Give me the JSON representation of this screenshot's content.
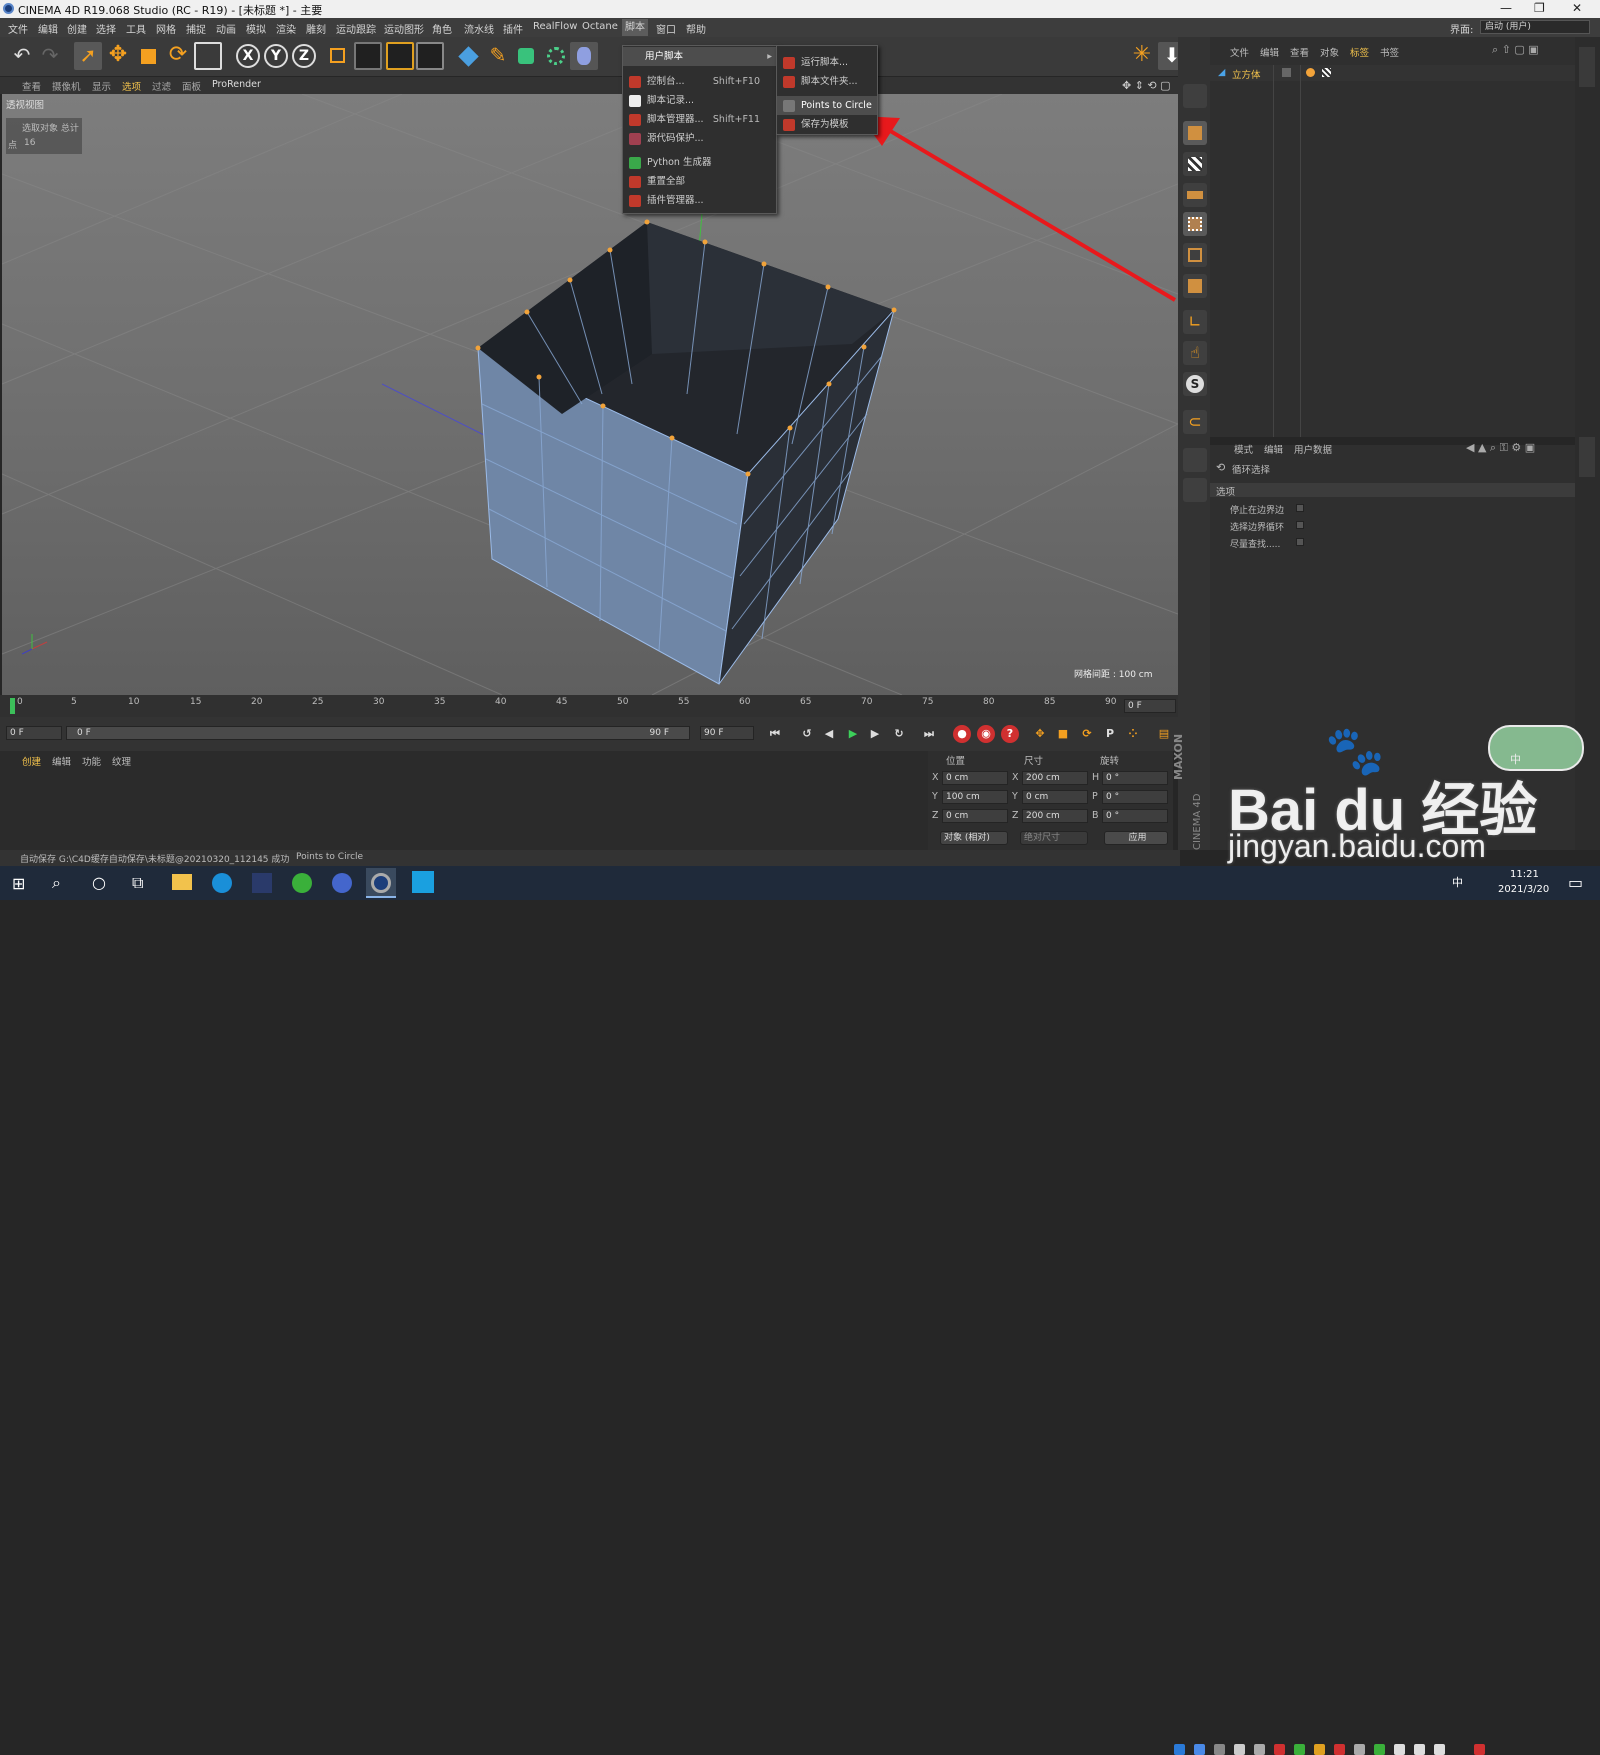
{
  "titlebar": {
    "title": "CINEMA 4D R19.068 Studio (RC - R19) - [未标题 *] - 主要",
    "min": "—",
    "max": "❐",
    "close": "✕"
  },
  "menubar": {
    "items": [
      "文件",
      "编辑",
      "创建",
      "选择",
      "工具",
      "网格",
      "捕捉",
      "动画",
      "模拟",
      "渲染",
      "雕刻",
      "运动跟踪",
      "运动图形",
      "角色",
      "流水线",
      "插件",
      "RealFlow",
      "Octane",
      "脚本",
      "窗口",
      "帮助"
    ],
    "layout_label": "界面:",
    "layout_value": "启动 (用户)"
  },
  "viewport_menu": {
    "items": [
      "查看",
      "摄像机",
      "显示",
      "选项",
      "过滤",
      "面板",
      "ProRender"
    ]
  },
  "viewport": {
    "name": "透视视图",
    "stats_header": "选取对象 总计",
    "stats_label": "点",
    "stats_value": "16",
    "grid_spacing": "网格间距 : 100 cm"
  },
  "axes": {
    "x": "X",
    "y": "Y",
    "z": "Z"
  },
  "script_menu": {
    "items": [
      {
        "label": "用户脚本",
        "shortcut": "",
        "icon": "submenu",
        "highlight": true,
        "arrow": "▸"
      },
      {
        "label": "控制台...",
        "shortcut": "Shift+F10",
        "icon": "console-icon"
      },
      {
        "label": "脚本记录...",
        "shortcut": "",
        "icon": "script-log-icon"
      },
      {
        "label": "脚本管理器...",
        "shortcut": "Shift+F11",
        "icon": "script-manager-icon"
      },
      {
        "label": "源代码保护...",
        "shortcut": "",
        "icon": "source-protect-icon"
      },
      {
        "label": "Python 生成器",
        "shortcut": "",
        "icon": "python-icon"
      },
      {
        "label": "重置全部",
        "shortcut": "",
        "icon": "reset-icon"
      },
      {
        "label": "插件管理器...",
        "shortcut": "",
        "icon": "plugin-manager-icon"
      }
    ]
  },
  "user_script_submenu": {
    "items": [
      {
        "label": "运行脚本...",
        "icon": "run-script-icon"
      },
      {
        "label": "脚本文件夹...",
        "icon": "script-folder-icon"
      },
      {
        "label": "Points to Circle",
        "icon": "points-to-circle-icon",
        "highlight": true
      },
      {
        "label": "保存为模板",
        "icon": "save-template-icon"
      }
    ]
  },
  "object_manager": {
    "menu": [
      "文件",
      "编辑",
      "查看",
      "对象",
      "标签",
      "书签"
    ],
    "object_name": "立方体"
  },
  "attribute_manager": {
    "menu": [
      "模式",
      "编辑",
      "用户数据"
    ],
    "tool_title": "循环选择",
    "section": "选项",
    "options": [
      "停止在边界边",
      "选择边界循环",
      "尽量查找....."
    ]
  },
  "timeline": {
    "ticks": [
      "0",
      "5",
      "10",
      "15",
      "20",
      "25",
      "30",
      "35",
      "40",
      "45",
      "50",
      "55",
      "60",
      "65",
      "70",
      "75",
      "80",
      "85",
      "90"
    ],
    "end_frame": "0 F"
  },
  "transport": {
    "start": "0 F",
    "range_start": "0 F",
    "range_end": "90 F",
    "end": "90 F"
  },
  "material_manager": {
    "menu": [
      "创建",
      "编辑",
      "功能",
      "纹理"
    ]
  },
  "coords": {
    "headers": [
      "位置",
      "尺寸",
      "旋转"
    ],
    "rows": [
      {
        "axis": "X",
        "pos": "0 cm",
        "size_axis": "X",
        "size": "200 cm",
        "rot_axis": "H",
        "rot": "0 °"
      },
      {
        "axis": "Y",
        "pos": "100 cm",
        "size_axis": "Y",
        "size": "0 cm",
        "rot_axis": "P",
        "rot": "0 °"
      },
      {
        "axis": "Z",
        "pos": "0 cm",
        "size_axis": "Z",
        "size": "200 cm",
        "rot_axis": "B",
        "rot": "0 °"
      }
    ],
    "mode": "对象 (相对)",
    "size_mode": "绝对尺寸",
    "apply": "应用"
  },
  "statusbar": {
    "text": "自动保存 G:\\C4D缓存自动保存\\未标题@20210320_112145 成功",
    "action": "Points to Circle"
  },
  "brand": {
    "maxon": "MAXON",
    "cinema": "CINEMA 4D"
  },
  "watermark": {
    "line1": "Bai du 经验",
    "line2": "jingyan.baidu.com"
  },
  "ime": {
    "text": "中"
  },
  "taskbar": {
    "time": "11:21",
    "date": "2021/3/20",
    "lang": "中"
  },
  "colors": {
    "accent_arrow": "#e8191c",
    "point_orange": "#f2a33a",
    "edge_blue": "#8ab4e8"
  }
}
